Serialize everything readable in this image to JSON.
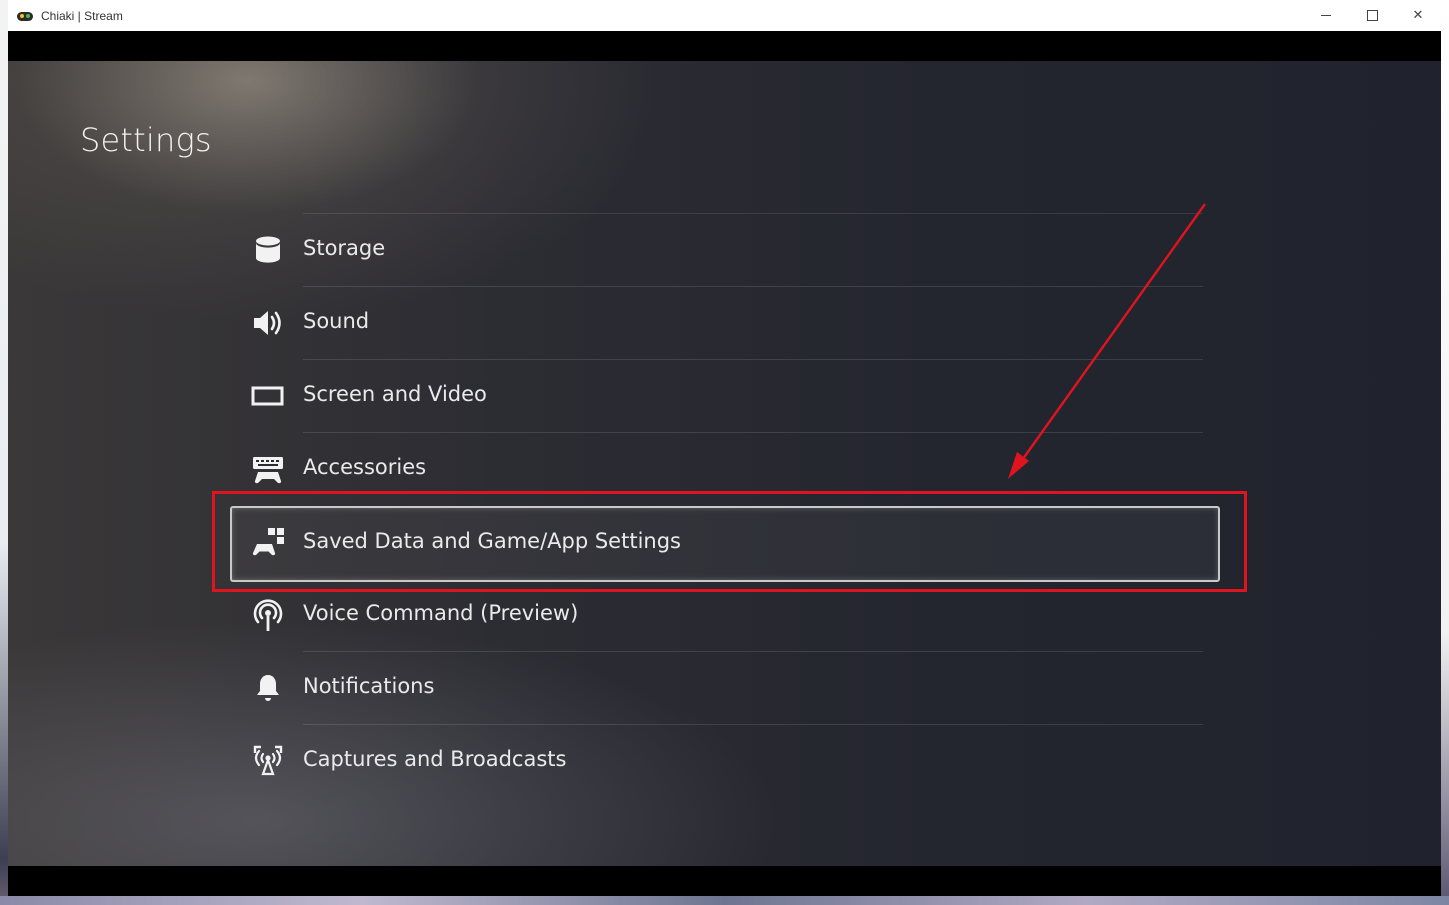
{
  "window": {
    "title": "Chiaki | Stream",
    "controls": {
      "minimize_icon": "minimize-icon",
      "maximize_icon": "maximize-icon",
      "close_glyph": "✕"
    }
  },
  "screen": {
    "title": "Settings",
    "items": [
      {
        "label": "Storage",
        "icon": "storage-icon"
      },
      {
        "label": "Sound",
        "icon": "speaker-icon"
      },
      {
        "label": "Screen and Video",
        "icon": "screen-icon"
      },
      {
        "label": "Accessories",
        "icon": "accessories-icon"
      },
      {
        "label": "Saved Data and Game/App Settings",
        "icon": "saved-data-icon",
        "selected": true
      },
      {
        "label": "Voice Command (Preview)",
        "icon": "voice-command-icon"
      },
      {
        "label": "Notifications",
        "icon": "bell-icon"
      },
      {
        "label": "Captures and Broadcasts",
        "icon": "broadcast-icon"
      }
    ]
  },
  "annotation": {
    "color": "#e0141e",
    "arrow_icon": "red-arrow-icon"
  },
  "colors": {
    "text": "#eaeaea",
    "selection_border": "#c9c9c9",
    "background": "#24262f"
  }
}
